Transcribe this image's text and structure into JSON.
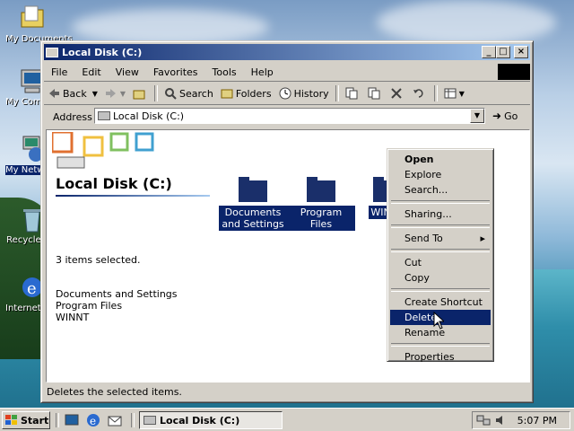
{
  "desktop": {
    "icons": [
      {
        "label": "My Documents",
        "name": "my-documents-icon"
      },
      {
        "label": "My Computer",
        "name": "my-computer-icon"
      },
      {
        "label": "My Network Places",
        "name": "network-places-icon"
      },
      {
        "label": "Recycle Bin",
        "name": "recycle-bin-icon"
      },
      {
        "label": "Internet Explorer",
        "name": "internet-explorer-icon"
      }
    ]
  },
  "window": {
    "title": "Local Disk (C:)",
    "menu": [
      "File",
      "Edit",
      "View",
      "Favorites",
      "Tools",
      "Help"
    ],
    "toolbar": {
      "back": "Back",
      "search": "Search",
      "folders": "Folders",
      "history": "History"
    },
    "address_label": "Address",
    "address_value": "Local Disk (C:)",
    "go_label": "Go",
    "pane": {
      "heading": "Local Disk (C:)",
      "selection_info": "3 items selected.",
      "selected_items": [
        "Documents and Settings",
        "Program Files",
        "WINNT"
      ]
    },
    "folders": [
      {
        "label": "Documents and Settings"
      },
      {
        "label": "Program Files"
      },
      {
        "label": "WINNT"
      }
    ],
    "status": "Deletes the selected items."
  },
  "context_menu": {
    "items": [
      "Open",
      "Explore",
      "Search...",
      "Sharing...",
      "Send To",
      "Cut",
      "Copy",
      "Create Shortcut",
      "Delete",
      "Rename",
      "Properties"
    ],
    "highlighted": "Delete"
  },
  "taskbar": {
    "start_label": "Start",
    "task_label": "Local Disk (C:)",
    "clock": "5:07 PM"
  },
  "colors": {
    "selection": "#0a246a",
    "face": "#d4d0c8"
  }
}
